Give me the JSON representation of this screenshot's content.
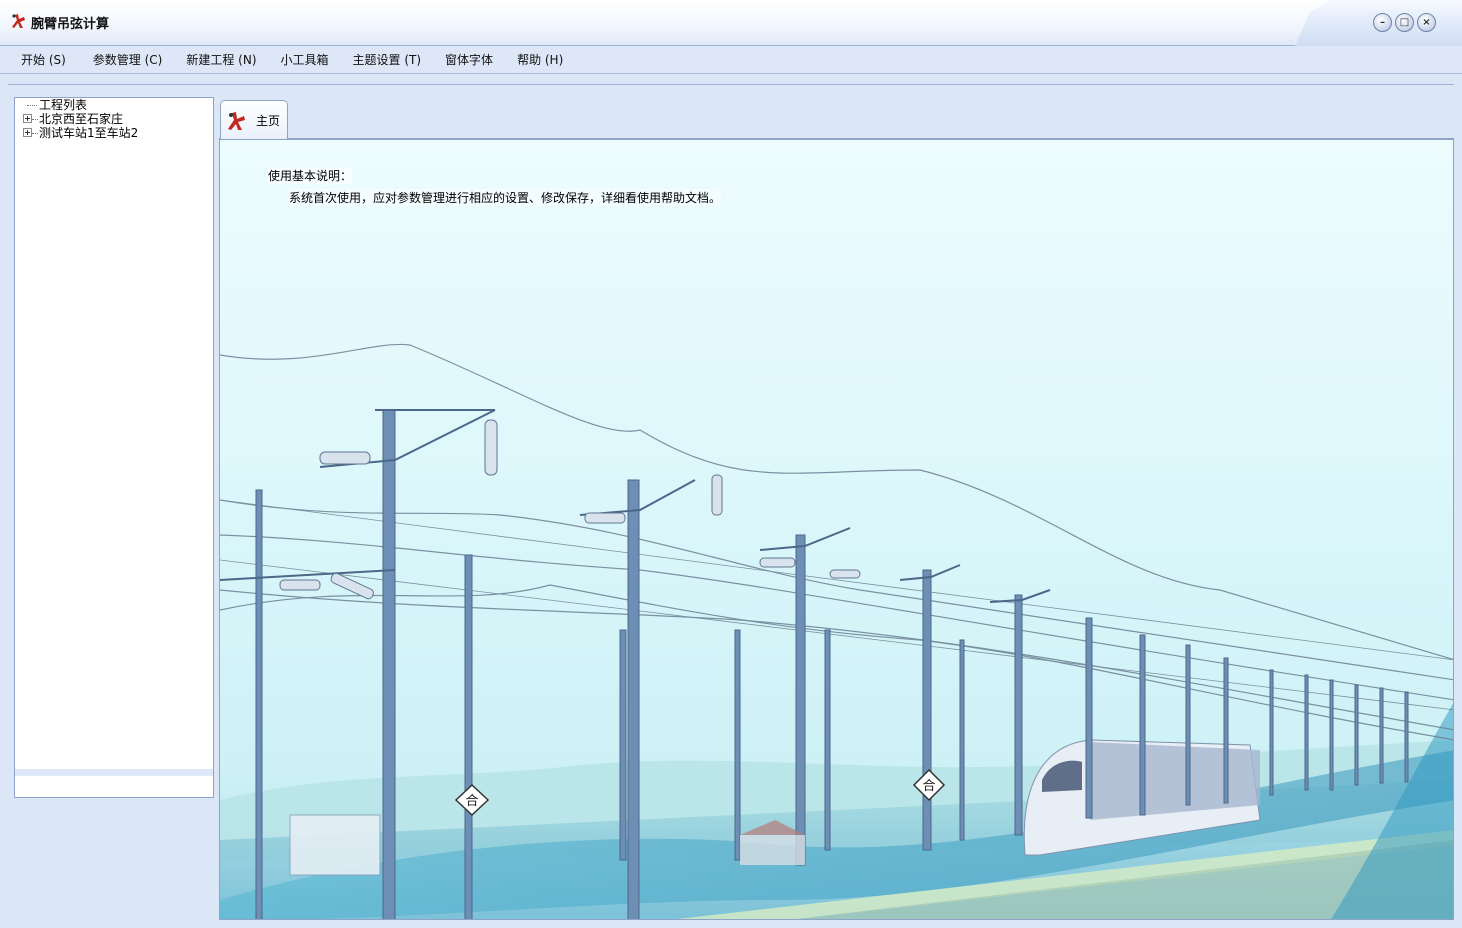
{
  "window": {
    "title": "腕臂吊弦计算",
    "controls": {
      "minimize": "–",
      "maximize": "□",
      "close": "×"
    }
  },
  "menu": [
    "开始 (S)",
    "参数管理 (C)",
    "新建工程 (N)",
    "小工具箱",
    "主题设置 (T)",
    "窗体字体",
    "帮助 (H)"
  ],
  "tree": {
    "root": "工程列表",
    "items": [
      "北京西至石家庄",
      "测试车站1至车站2"
    ]
  },
  "tabs": [
    {
      "label": "主页"
    }
  ],
  "home": {
    "instruction_title": "使用基本说明：",
    "instruction_body": "系统首次使用，应对参数管理进行相应的设置、修改保存，详细看使用帮助文档。",
    "sign_text": "合"
  },
  "colors": {
    "chrome": "#dbe6f7",
    "sky": "#dcf7fb",
    "pole": "#5c7a9c",
    "wire": "#6b7f93"
  },
  "icons": [
    "app-logo-icon",
    "minimize-icon",
    "maximize-icon",
    "close-icon",
    "tree-expand-icon",
    "home-tab-icon"
  ]
}
